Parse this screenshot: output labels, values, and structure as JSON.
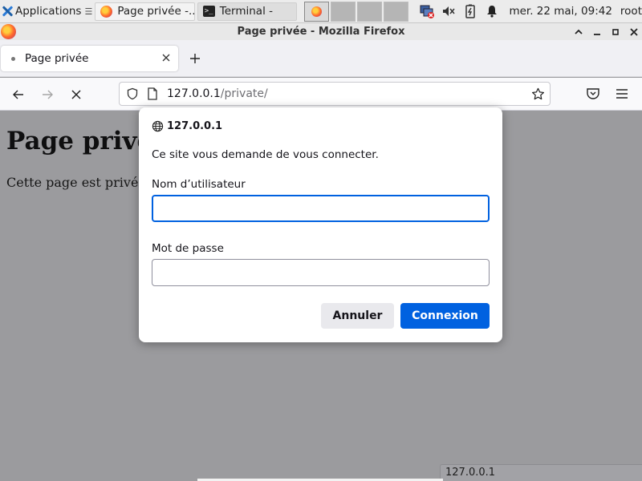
{
  "panel": {
    "apps_label": "Applications",
    "apps_sep": "☰",
    "tasks": [
      {
        "label": "Page privée -...",
        "icon": "firefox-icon",
        "active": true
      },
      {
        "label": "Terminal -",
        "icon": "terminal-icon",
        "active": false
      }
    ],
    "clock": "mer. 22 mai, 09:42",
    "user": "root"
  },
  "window": {
    "title": "Page privée - Mozilla Firefox"
  },
  "tabs": [
    {
      "title": "Page privée"
    }
  ],
  "navbar": {
    "url_host": "127.0.0.1",
    "url_path": "/private/"
  },
  "page": {
    "heading": "Page privée",
    "paragraph": "Cette page est privée."
  },
  "status": {
    "text": "127.0.0.1"
  },
  "auth_dialog": {
    "origin": "127.0.0.1",
    "message": "Ce site vous demande de vous connecter.",
    "username_label": "Nom d’utilisateur",
    "username_value": "",
    "password_label": "Mot de passe",
    "password_value": "",
    "cancel_label": "Annuler",
    "ok_label": "Connexion"
  },
  "colors": {
    "accent": "#0061e0",
    "overlay": "#9b9b9e"
  }
}
